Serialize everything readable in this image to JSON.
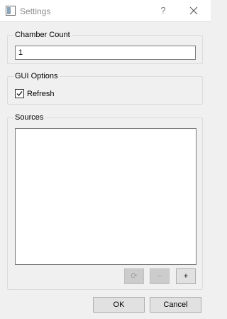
{
  "window": {
    "title": "Settings",
    "help_label": "?",
    "icons": {
      "app": "app-window-icon",
      "close": "close-icon"
    }
  },
  "chamber_count": {
    "group_title": "Chamber Count",
    "value": "1"
  },
  "gui_options": {
    "group_title": "GUI Options",
    "refresh_label": "Refresh",
    "refresh_checked": true
  },
  "sources": {
    "group_title": "Sources",
    "items": [],
    "buttons": {
      "refresh": {
        "icon": "refresh-icon",
        "glyph": "⟳",
        "enabled": false
      },
      "remove": {
        "icon": "minus-icon",
        "glyph": "−",
        "enabled": false
      },
      "add": {
        "icon": "plus-icon",
        "glyph": "+",
        "enabled": true
      }
    }
  },
  "dialog_buttons": {
    "ok_label": "OK",
    "cancel_label": "Cancel"
  }
}
